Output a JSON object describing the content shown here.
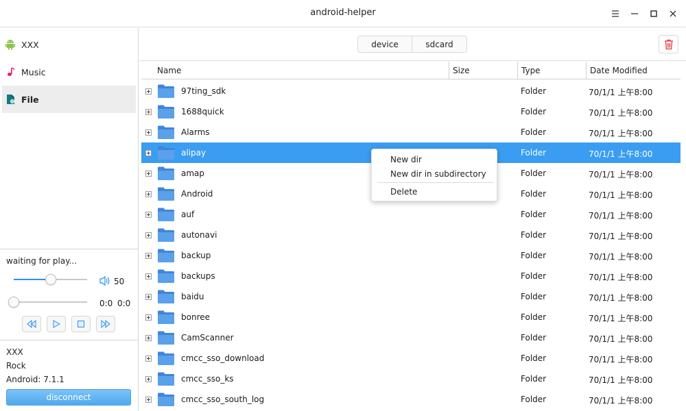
{
  "window": {
    "title": "android-helper"
  },
  "sidebar": {
    "items": [
      {
        "label": "XXX",
        "icon": "android-icon"
      },
      {
        "label": "Music",
        "icon": "music-note-icon"
      },
      {
        "label": "File",
        "icon": "file-icon"
      }
    ],
    "active_item": "File"
  },
  "player": {
    "status": "waiting for play...",
    "volume": 50,
    "volume_fraction": 0.5,
    "progress_fraction": 0.0,
    "time_current": "0:0",
    "time_total": "0:0"
  },
  "device": {
    "name": "XXX",
    "brand": "Rock",
    "android_version": "Android: 7.1.1",
    "disconnect_label": "disconnect"
  },
  "toolbar": {
    "device_label": "device",
    "sdcard_label": "sdcard"
  },
  "table": {
    "columns": [
      "Name",
      "Size",
      "Type",
      "Date Modified"
    ],
    "rows": [
      {
        "name": "97ting_sdk",
        "size": "",
        "type": "Folder",
        "date": "70/1/1 上午8:00"
      },
      {
        "name": "1688quick",
        "size": "",
        "type": "Folder",
        "date": "70/1/1 上午8:00"
      },
      {
        "name": "Alarms",
        "size": "",
        "type": "Folder",
        "date": "70/1/1 上午8:00"
      },
      {
        "name": "alipay",
        "size": "",
        "type": "Folder",
        "date": "70/1/1 上午8:00",
        "selected": true
      },
      {
        "name": "amap",
        "size": "",
        "type": "Folder",
        "date": "70/1/1 上午8:00"
      },
      {
        "name": "Android",
        "size": "",
        "type": "Folder",
        "date": "70/1/1 上午8:00"
      },
      {
        "name": "auf",
        "size": "",
        "type": "Folder",
        "date": "70/1/1 上午8:00"
      },
      {
        "name": "autonavi",
        "size": "",
        "type": "Folder",
        "date": "70/1/1 上午8:00"
      },
      {
        "name": "backup",
        "size": "",
        "type": "Folder",
        "date": "70/1/1 上午8:00"
      },
      {
        "name": "backups",
        "size": "",
        "type": "Folder",
        "date": "70/1/1 上午8:00"
      },
      {
        "name": "baidu",
        "size": "",
        "type": "Folder",
        "date": "70/1/1 上午8:00"
      },
      {
        "name": "bonree",
        "size": "",
        "type": "Folder",
        "date": "70/1/1 上午8:00"
      },
      {
        "name": "CamScanner",
        "size": "",
        "type": "Folder",
        "date": "70/1/1 上午8:00"
      },
      {
        "name": "cmcc_sso_download",
        "size": "",
        "type": "Folder",
        "date": "70/1/1 上午8:00"
      },
      {
        "name": "cmcc_sso_ks",
        "size": "",
        "type": "Folder",
        "date": "70/1/1 上午8:00"
      },
      {
        "name": "cmcc_sso_south_log",
        "size": "",
        "type": "Folder",
        "date": "70/1/1 上午8:00"
      }
    ]
  },
  "context_menu": {
    "items": [
      "New dir",
      "New dir in subdirectory",
      "Delete"
    ]
  },
  "colors": {
    "accent": "#3a9df1",
    "folder": "#4a90e2",
    "delete_red": "#e0393e",
    "android_green": "#8bc34a",
    "music_pink": "#e91e63",
    "file_teal": "#137a7f"
  }
}
